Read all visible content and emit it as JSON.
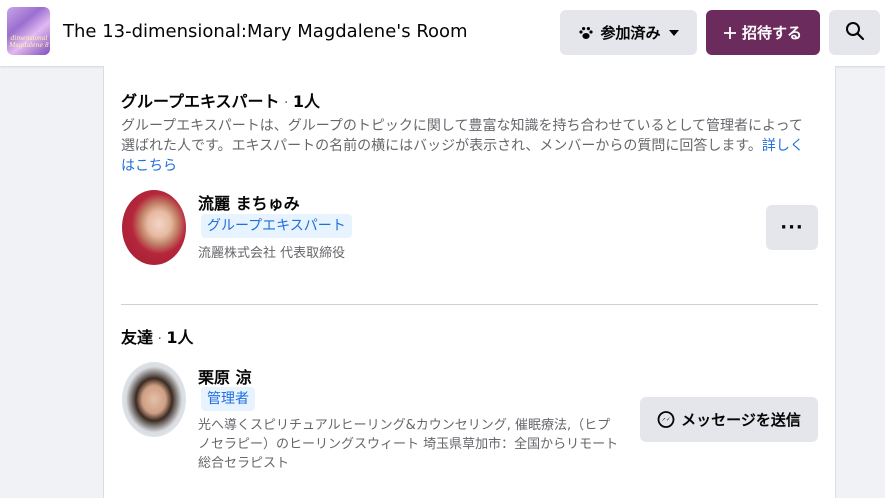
{
  "header": {
    "thumbnail_text": "dimensional\nMagdalene 8",
    "group_name": "The 13-dimensional:Mary Magdalene's Room",
    "joined_label": "参加済み",
    "invite_label": "招待する",
    "icons": {
      "joined": "paw-icon",
      "joined_caret": "caret-down-icon",
      "invite": "plus-icon",
      "search": "search-icon"
    }
  },
  "experts_section": {
    "title": "グループエキスパート",
    "count_sep": " · ",
    "count": "1人",
    "description": "グループエキスパートは、グループのトピックに関して豊富な知識を持ち合わせているとして管理者によって選ばれた人です。エキスパートの名前の横にはバッジが表示され、メンバーからの質問に回答します。",
    "learn_more": "詳しくはこちら",
    "member": {
      "name": "流麗 まちゅみ",
      "badge": "グループエキスパート",
      "subtitle": "流麗株式会社 代表取締役",
      "more_label": "···"
    }
  },
  "friends_section": {
    "title": "友達",
    "count_sep": " · ",
    "count": "1人",
    "member": {
      "name": "栗原 涼",
      "badge": "管理者",
      "subtitle": "光へ導くスピリチュアルヒーリング&カウンセリング, 催眠療法,（ヒプノセラピー）のヒーリングスウィート 埼玉県草加市：全国からリモート 総合セラピスト",
      "message_label": "メッセージを送信",
      "message_icon": "messenger-icon"
    }
  },
  "colors": {
    "accent_invite": "#6b2b5d",
    "link": "#216fdb",
    "badge_bg": "#e7f3ff",
    "button_gray": "#e4e6eb",
    "page_bg": "#f0f2f5"
  }
}
